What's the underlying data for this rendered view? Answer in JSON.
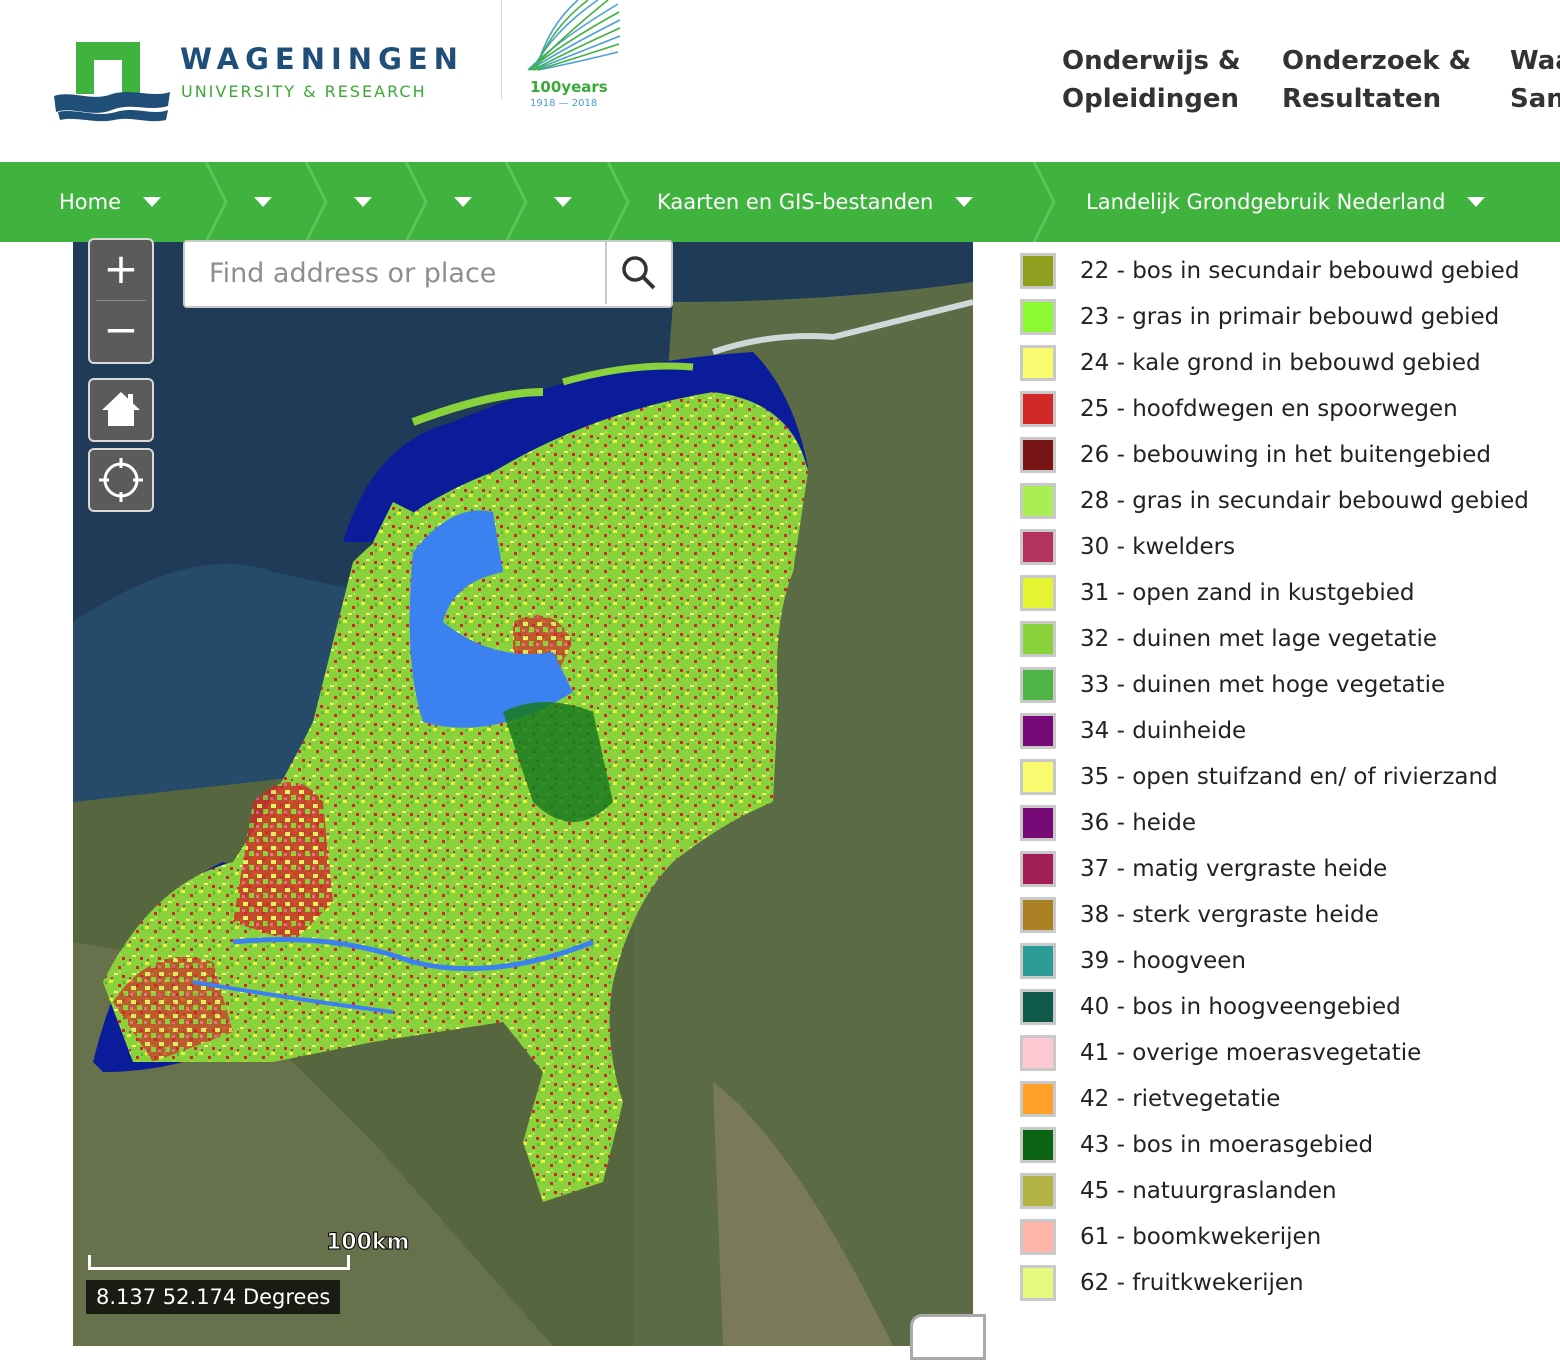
{
  "header": {
    "brand_name": "WAGENINGEN",
    "brand_sub": "UNIVERSITY & RESEARCH",
    "anniversary": {
      "label": "100years",
      "years": "1918 — 2018"
    },
    "nav": [
      {
        "line1": "Onderwijs &",
        "line2": "Opleidingen"
      },
      {
        "line1": "Onderzoek &",
        "line2": "Resultaten"
      },
      {
        "line1": "Waa",
        "line2": "San"
      }
    ]
  },
  "breadcrumbs": [
    {
      "label": "Home"
    },
    {
      "label": ""
    },
    {
      "label": ""
    },
    {
      "label": ""
    },
    {
      "label": ""
    },
    {
      "label": "Kaarten en GIS-bestanden"
    },
    {
      "label": "Landelijk Grondgebruik Nederland"
    }
  ],
  "map": {
    "search_placeholder": "Find address or place",
    "zoom_in": "+",
    "zoom_out": "−",
    "scale_label": "100km",
    "coordinates": "8.137 52.174 Degrees"
  },
  "legend": [
    {
      "label": "22 - bos in secundair bebouwd gebied",
      "color": "#8fa01e"
    },
    {
      "label": "23 - gras in primair bebouwd gebied",
      "color": "#8cfa32"
    },
    {
      "label": "24 - kale grond in bebouwd gebied",
      "color": "#fafa6e"
    },
    {
      "label": "25 - hoofdwegen en spoorwegen",
      "color": "#d22828"
    },
    {
      "label": "26 - bebouwing in het buitengebied",
      "color": "#781414"
    },
    {
      "label": "28 - gras in secundair bebouwd gebied",
      "color": "#aaee55"
    },
    {
      "label": "30 - kwelders",
      "color": "#b4325f"
    },
    {
      "label": "31 - open zand in kustgebied",
      "color": "#e6f532"
    },
    {
      "label": "32 - duinen met lage vegetatie",
      "color": "#8ad23c"
    },
    {
      "label": "33 - duinen met hoge vegetatie",
      "color": "#50b446"
    },
    {
      "label": "34 - duinheide",
      "color": "#780a78"
    },
    {
      "label": "35 - open stuifzand en/ of rivierzand",
      "color": "#fafa6e"
    },
    {
      "label": "36 - heide",
      "color": "#780a78"
    },
    {
      "label": "37 - matig vergraste heide",
      "color": "#a01e55"
    },
    {
      "label": "38 - sterk vergraste heide",
      "color": "#aa8223"
    },
    {
      "label": "39 - hoogveen",
      "color": "#2d9b96"
    },
    {
      "label": "40 - bos in hoogveengebied",
      "color": "#0f5a4b"
    },
    {
      "label": "41 - overige moerasvegetatie",
      "color": "#ffc8d2"
    },
    {
      "label": "42 - rietvegetatie",
      "color": "#ffa028"
    },
    {
      "label": "43 - bos in moerasgebied",
      "color": "#0a6414"
    },
    {
      "label": "45 - natuurgraslanden",
      "color": "#b4b446"
    },
    {
      "label": "61 - boomkwekerijen",
      "color": "#ffb4aa"
    },
    {
      "label": "62 - fruitkwekerijen",
      "color": "#e6fa82"
    }
  ]
}
